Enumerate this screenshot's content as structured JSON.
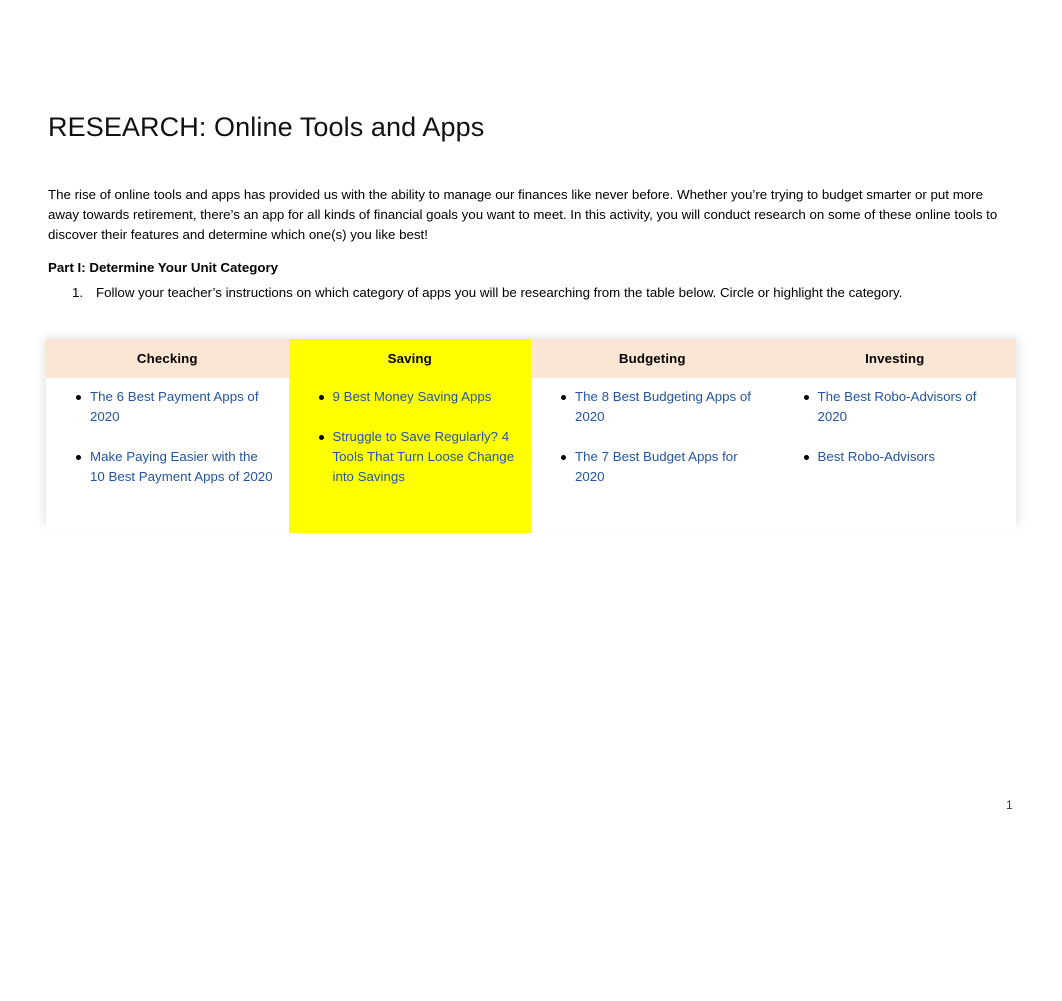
{
  "document": {
    "title": "RESEARCH: Online Tools and Apps",
    "intro": "The rise of online tools and apps has provided us with the ability to manage our finances like never before. Whether you’re trying to budget smarter or put more away towards retirement, there’s an app for all kinds of financial goals you want to meet. In this activity, you will conduct research on some of these online tools to discover their features and determine which one(s) you like best!",
    "part_heading": "Part I: Determine Your Unit Category",
    "instruction": {
      "number": "1.",
      "text": "Follow your teacher’s instructions on which category of apps you will be researching from the table below. Circle or highlight the category."
    },
    "page_number": "1"
  },
  "colors": {
    "header_background": "#FAE6D2",
    "highlight": "#FFFF00",
    "link": "#2255A4",
    "text": "#000000",
    "page_background": "#FFFFFF"
  },
  "table": {
    "columns": [
      {
        "header": "Checking",
        "highlighted": false,
        "links": [
          "The 6 Best Payment Apps of 2020",
          "Make Paying Easier with the 10 Best Payment Apps of 2020"
        ]
      },
      {
        "header": "Saving",
        "highlighted": true,
        "links": [
          "9 Best Money Saving Apps",
          "Struggle to Save Regularly? 4 Tools That Turn Loose Change into Savings"
        ]
      },
      {
        "header": "Budgeting",
        "highlighted": false,
        "links": [
          "The 8 Best Budgeting Apps of 2020",
          "The 7 Best Budget Apps for 2020"
        ]
      },
      {
        "header": "Investing",
        "highlighted": false,
        "links": [
          "The Best Robo-Advisors of 2020",
          "Best Robo-Advisors"
        ]
      }
    ]
  }
}
